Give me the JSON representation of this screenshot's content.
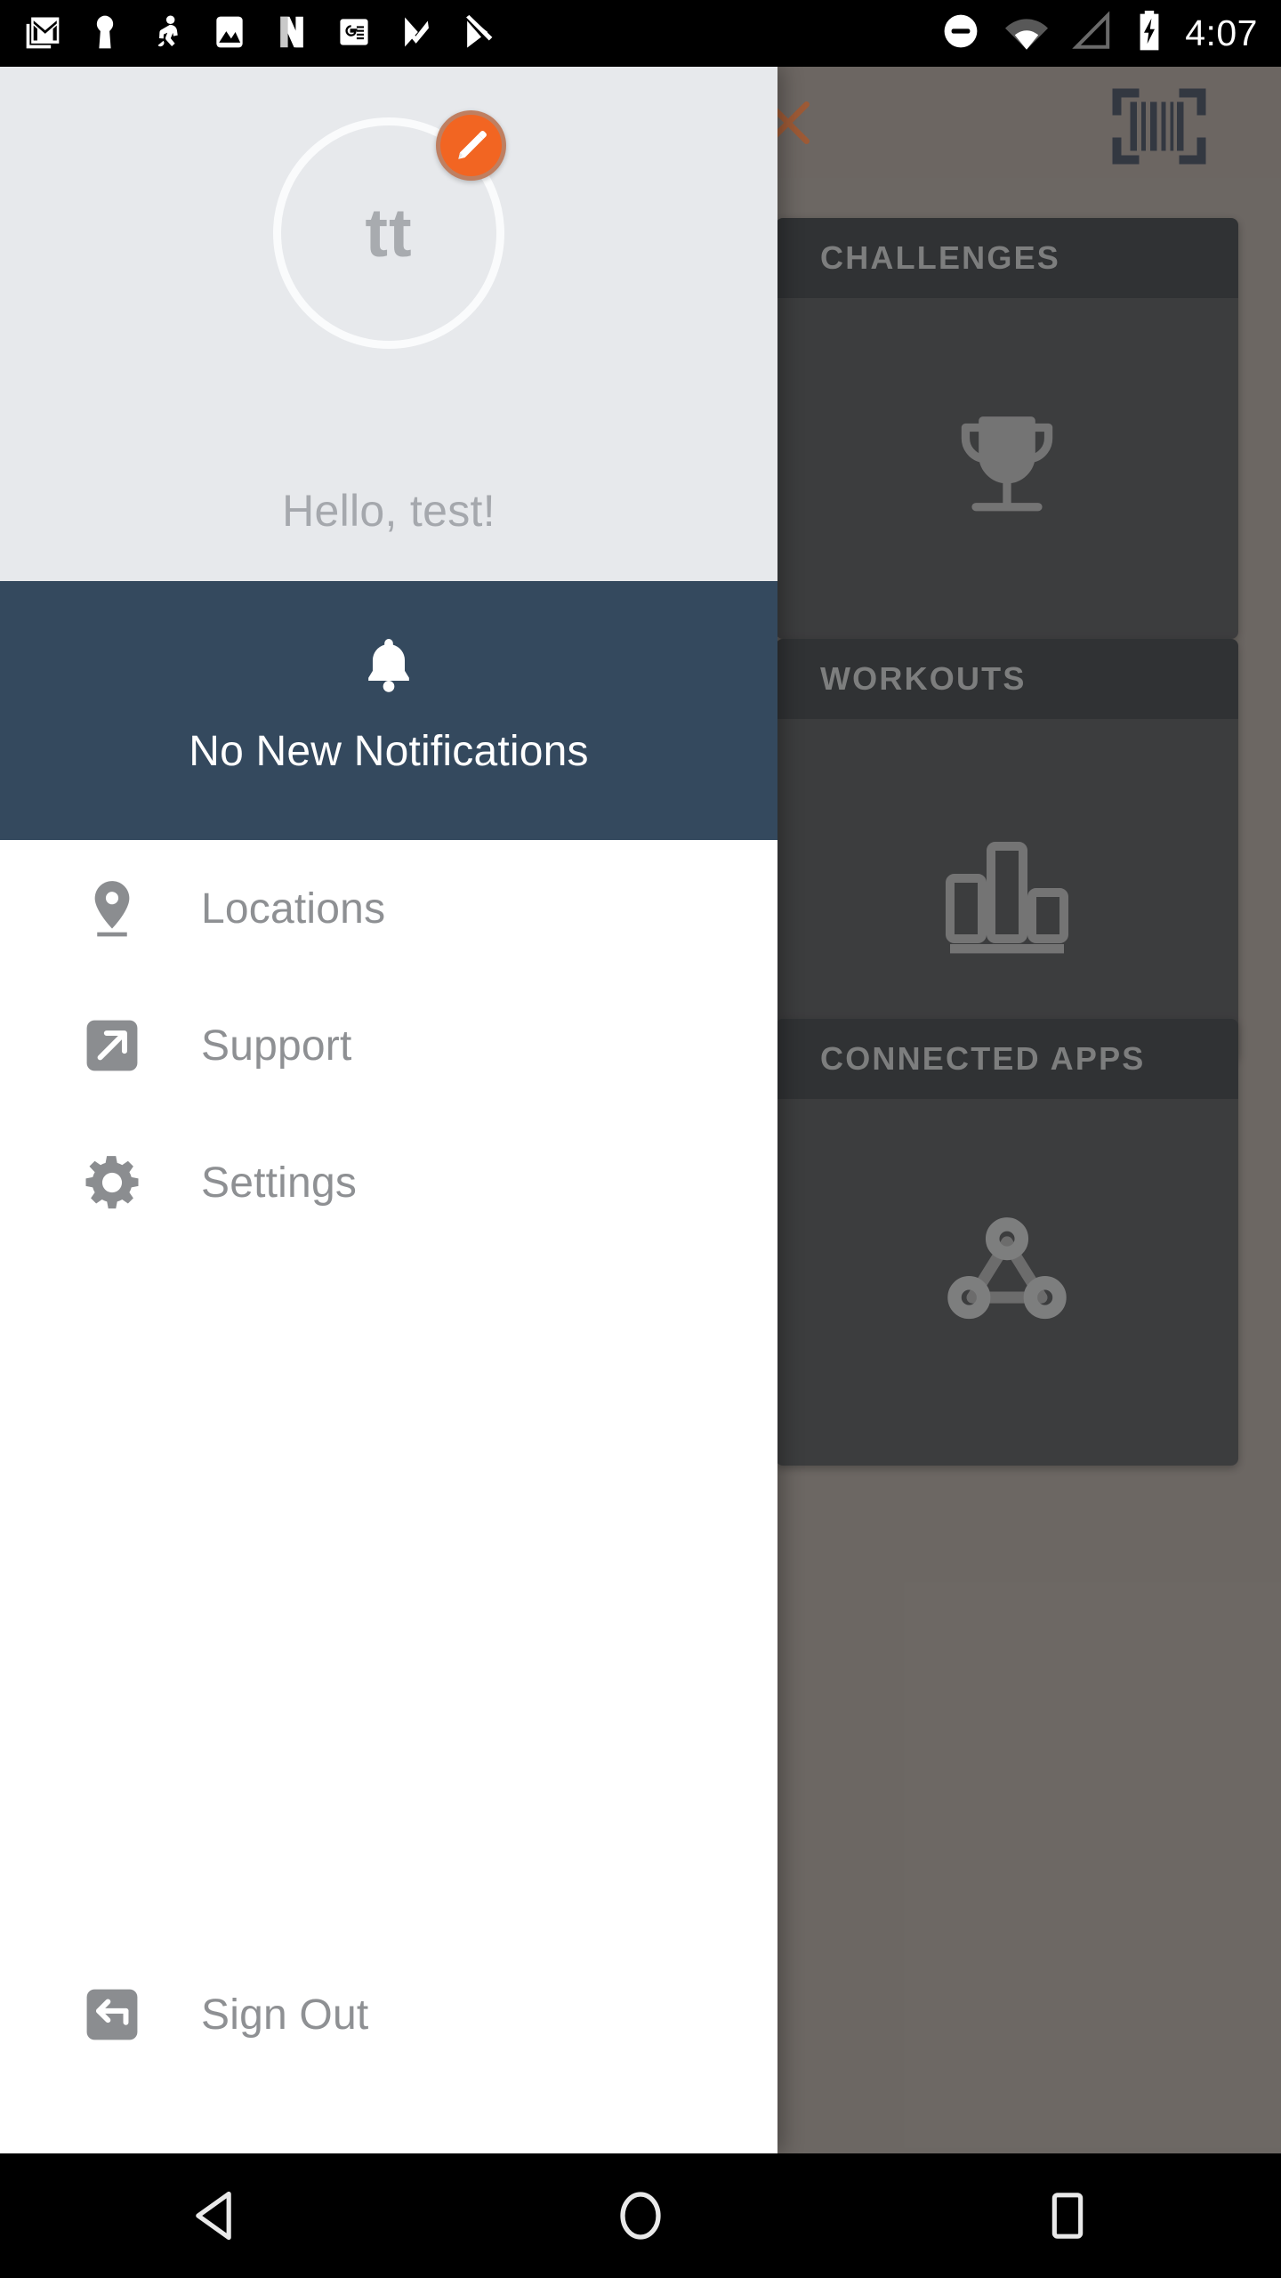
{
  "status_bar": {
    "time": "4:07",
    "left_icons": [
      "gmail-icon",
      "keyhole-icon",
      "runner-icon",
      "photos-icon",
      "netflix-icon",
      "google-news-icon",
      "tasks-check-icon",
      "play-store-icon"
    ],
    "right_icons": [
      "do-not-disturb-icon",
      "wifi-icon",
      "cell-signal-icon",
      "battery-charging-icon"
    ]
  },
  "drawer": {
    "header": {
      "avatar_initials": "tt",
      "edit_badge_icon": "pencil-icon",
      "greeting": "Hello, test!"
    },
    "notification_banner": {
      "icon": "bell-icon",
      "text": "No New Notifications",
      "background_color": "#34495E"
    },
    "menu_items": [
      {
        "label": "Locations",
        "icon": "map-pin-icon"
      },
      {
        "label": "Support",
        "icon": "external-link-icon"
      },
      {
        "label": "Settings",
        "icon": "gear-icon"
      }
    ],
    "sign_out": {
      "label": "Sign Out",
      "icon": "sign-out-arrow-icon"
    }
  },
  "background": {
    "toolbar": {
      "close_icon": "close-x-icon",
      "close_icon_color": "#C85A20",
      "scan_icon": "barcode-scan-icon"
    },
    "cards": [
      {
        "title": "CHALLENGES",
        "icon": "trophy-icon"
      },
      {
        "title": "WORKOUTS",
        "icon": "bar-chart-icon"
      },
      {
        "title": "CONNECTED APPS",
        "icon": "network-nodes-icon"
      }
    ]
  },
  "nav_bar": {
    "buttons": [
      {
        "name": "back",
        "icon": "triangle-back-icon"
      },
      {
        "name": "home",
        "icon": "circle-home-icon"
      },
      {
        "name": "recents",
        "icon": "square-recents-icon"
      }
    ]
  },
  "colors": {
    "accent_orange": "#F26522",
    "banner_navy": "#34495E",
    "header_gray": "#E7E9EC",
    "card_dark": "#1F2329",
    "card_header_dark": "#0B1118"
  }
}
